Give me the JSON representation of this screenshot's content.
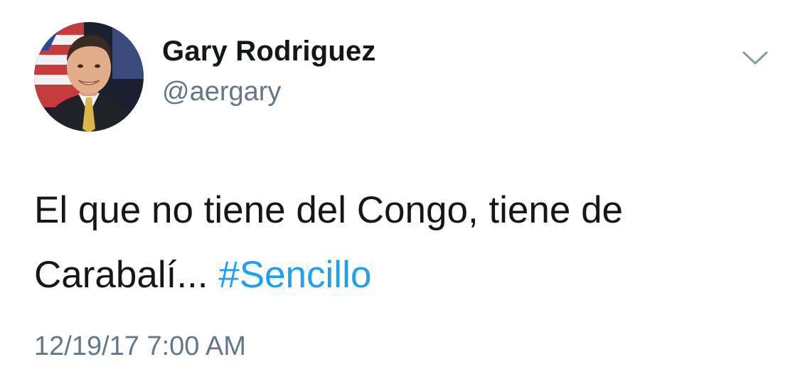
{
  "author": {
    "display_name": "Gary Rodriguez",
    "handle": "@aergary",
    "avatar_icon": "profile-photo-icon"
  },
  "menu": {
    "icon": "chevron-down-icon"
  },
  "tweet": {
    "text": "El que no tiene del Congo, tiene de Carabalí... ",
    "hashtag": "#Sencillo",
    "timestamp": "12/19/17 7:00 AM"
  },
  "colors": {
    "text_primary": "#14171a",
    "text_secondary": "#657786",
    "link": "#1da1f2",
    "background": "#ffffff"
  }
}
